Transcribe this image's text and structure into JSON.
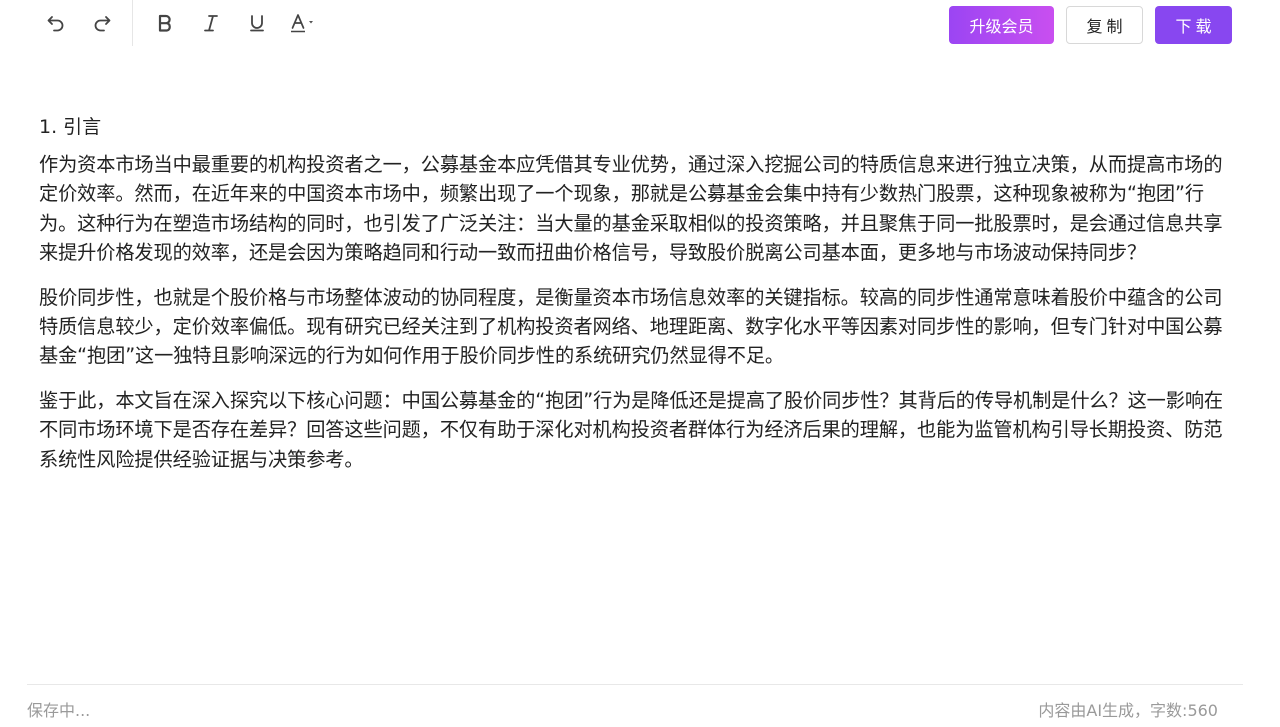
{
  "toolbar": {
    "tools": [
      {
        "name": "undo-icon"
      },
      {
        "name": "redo-icon"
      },
      {
        "name": "bold-icon"
      },
      {
        "name": "italic-icon"
      },
      {
        "name": "underline-icon"
      },
      {
        "name": "font-color-icon"
      }
    ],
    "upgrade_label": "升级会员",
    "copy_label": "复制",
    "download_label": "下载",
    "colors": {
      "upgrade_start": "#9b45f3",
      "upgrade_end": "#c94ff0",
      "download": "#8847f0"
    }
  },
  "document": {
    "heading": "1. 引言",
    "paragraphs": [
      "作为资本市场当中最重要的机构投资者之一，公募基金本应凭借其专业优势，通过深入挖掘公司的特质信息来进行独立决策，从而提高市场的定价效率。然而，在近年来的中国资本市场中，频繁出现了一个现象，那就是公募基金会集中持有少数热门股票，这种现象被称为“抱团”行为。这种行为在塑造市场结构的同时，也引发了广泛关注：当大量的基金采取相似的投资策略，并且聚焦于同一批股票时，是会通过信息共享来提升价格发现的效率，还是会因为策略趋同和行动一致而扭曲价格信号，导致股价脱离公司基本面，更多地与市场波动保持同步？",
      "股价同步性，也就是个股价格与市场整体波动的协同程度，是衡量资本市场信息效率的关键指标。较高的同步性通常意味着股价中蕴含的公司特质信息较少，定价效率偏低。现有研究已经关注到了机构投资者网络、地理距离、数字化水平等因素对同步性的影响，但专门针对中国公募基金“抱团”这一独特且影响深远的行为如何作用于股价同步性的系统研究仍然显得不足。",
      "鉴于此，本文旨在深入探究以下核心问题：中国公募基金的“抱团”行为是降低还是提高了股价同步性？其背后的传导机制是什么？这一影响在不同市场环境下是否存在差异？回答这些问题，不仅有助于深化对机构投资者群体行为经济后果的理解，也能为监管机构引导长期投资、防范系统性风险提供经验证据与决策参考。"
    ]
  },
  "footer": {
    "status": "保存中...",
    "info": "内容由AI生成，字数:560"
  }
}
